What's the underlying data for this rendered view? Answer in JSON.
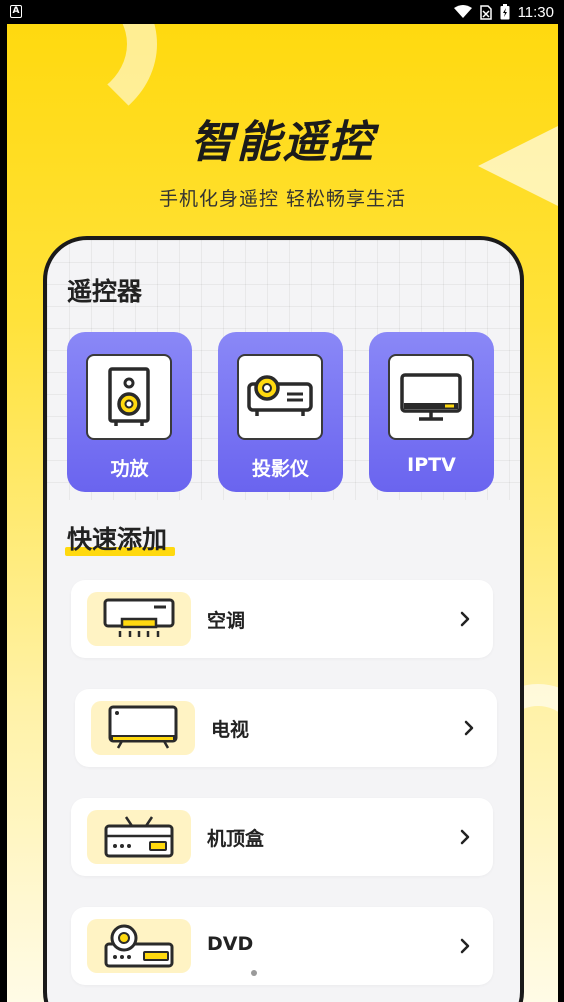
{
  "status_bar": {
    "left_badge": "A",
    "time": "11:30"
  },
  "hero": {
    "title": "智能遥控",
    "subtitle": "手机化身遥控 轻松畅享生活"
  },
  "remote_section": {
    "title": "遥控器",
    "cards": [
      {
        "label": "功放",
        "icon": "speaker-icon"
      },
      {
        "label": "投影仪",
        "icon": "projector-icon"
      },
      {
        "label": "IPTV",
        "icon": "tv-monitor-icon"
      }
    ]
  },
  "quick_add": {
    "title": "快速添加",
    "items": [
      {
        "label": "空调",
        "icon": "air-conditioner-icon"
      },
      {
        "label": "电视",
        "icon": "television-icon"
      },
      {
        "label": "机顶盒",
        "icon": "set-top-box-icon"
      },
      {
        "label": "DVD",
        "icon": "dvd-player-icon"
      }
    ]
  },
  "colors": {
    "yellow": "#ffd90f",
    "purple": "#6a64ef",
    "dark": "#1a1a1a"
  }
}
